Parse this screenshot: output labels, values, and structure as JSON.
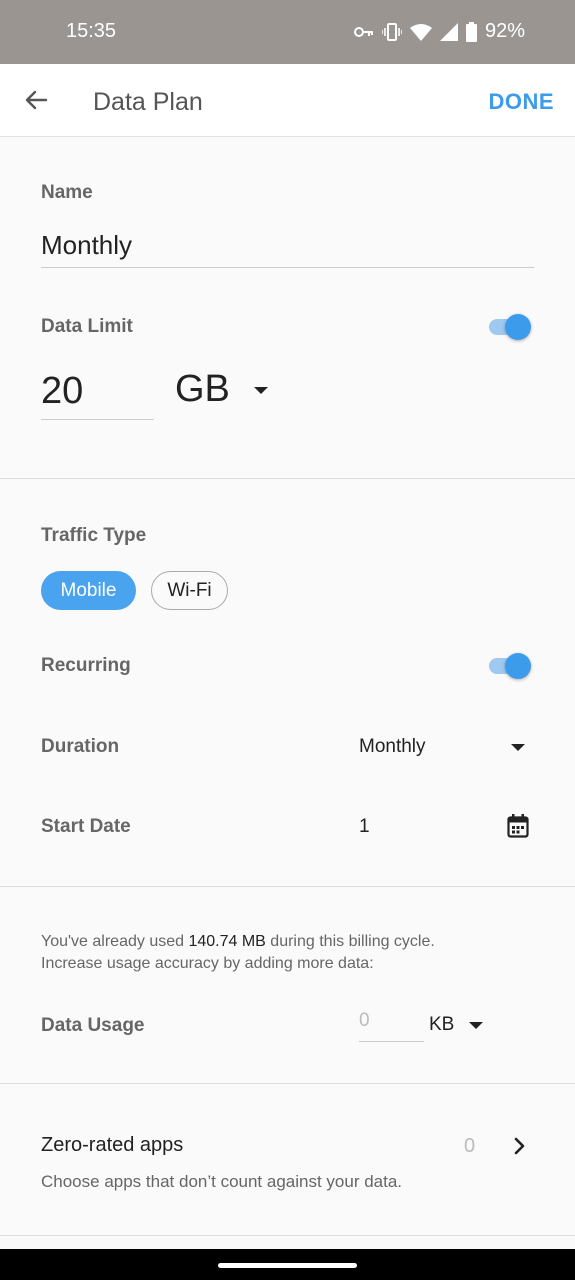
{
  "statusbar": {
    "time": "15:35",
    "battery": "92%"
  },
  "appbar": {
    "title": "Data Plan",
    "done_label": "DONE"
  },
  "name": {
    "label": "Name",
    "value": "Monthly"
  },
  "data_limit": {
    "label": "Data Limit",
    "enabled": true,
    "value": "20",
    "unit": "GB"
  },
  "traffic_type": {
    "label": "Traffic Type",
    "options": [
      "Mobile",
      "Wi-Fi"
    ],
    "selected": "Mobile"
  },
  "recurring": {
    "label": "Recurring",
    "enabled": true
  },
  "duration": {
    "label": "Duration",
    "value": "Monthly"
  },
  "start_date": {
    "label": "Start Date",
    "value": "1"
  },
  "usage_info": {
    "prefix": "You've already used ",
    "amount": "140.74 MB",
    "suffix": " during this billing cycle.",
    "line2": "Increase usage accuracy by adding more data:"
  },
  "data_usage": {
    "label": "Data Usage",
    "placeholder": "0",
    "unit": "KB"
  },
  "zero_rated": {
    "title": "Zero-rated apps",
    "count": "0",
    "description": "Choose apps that don’t count against your data."
  },
  "colors": {
    "accent": "#3d9bec",
    "statusbar": "#9a9591"
  }
}
